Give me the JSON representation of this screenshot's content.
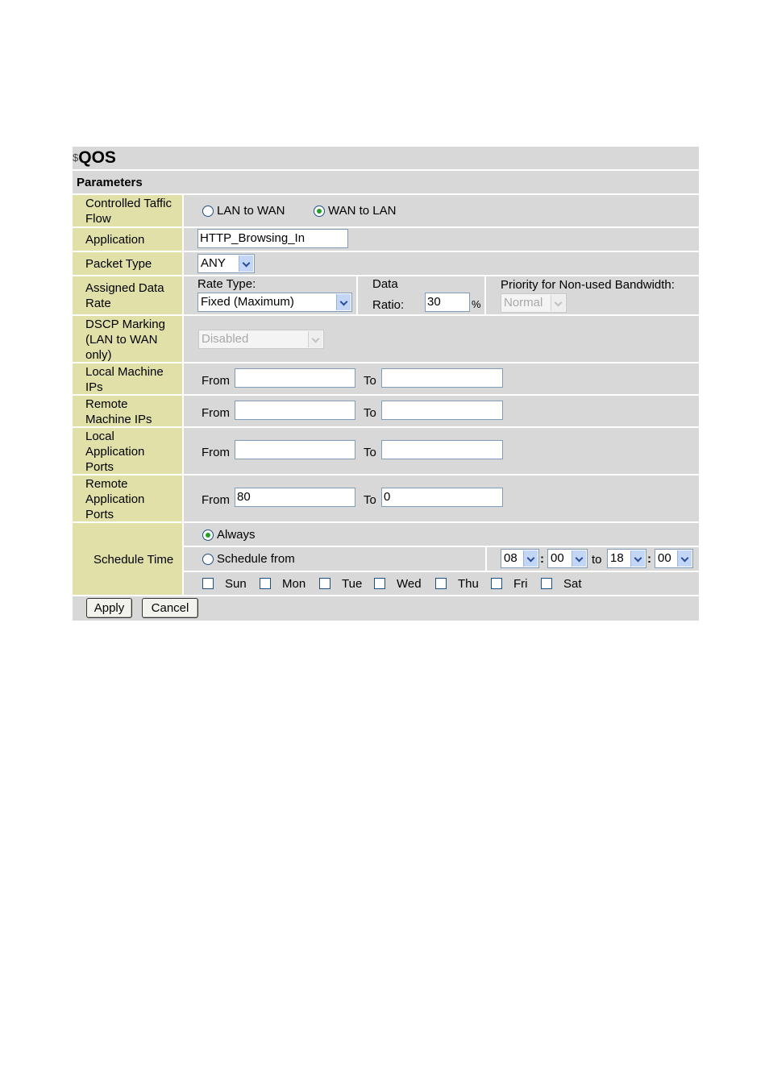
{
  "header": {
    "mark": "$",
    "title": "QOS",
    "section": "Parameters"
  },
  "controlled_traffic": {
    "label_lines": [
      "Controlled Taffic",
      "Flow"
    ],
    "options": [
      "LAN to WAN",
      "WAN to LAN"
    ],
    "selected": "WAN to LAN"
  },
  "application": {
    "label": "Application",
    "value": "HTTP_Browsing_In"
  },
  "packet_type": {
    "label": "Packet Type",
    "value": "ANY"
  },
  "assigned_rate": {
    "label_lines": [
      "Assigned Data",
      "Rate"
    ],
    "rate_type_label": "Rate Type:",
    "rate_type_value": "Fixed (Maximum)",
    "data_label": "Data",
    "ratio_label": "Ratio:",
    "ratio_value": "30",
    "percent": "%",
    "priority_label": "Priority for Non-used Bandwidth:",
    "priority_value": "Normal"
  },
  "dscp": {
    "label_lines": [
      "DSCP Marking",
      "(LAN to WAN",
      "only)"
    ],
    "value": "Disabled"
  },
  "local_ips": {
    "label_lines": [
      "Local Machine",
      "IPs"
    ],
    "from_label": "From",
    "to_label": "To",
    "from": "",
    "to": ""
  },
  "remote_ips": {
    "label_lines": [
      "Remote",
      "Machine IPs"
    ],
    "from_label": "From",
    "to_label": "To",
    "from": "",
    "to": ""
  },
  "local_ports": {
    "label_lines": [
      "Local",
      "Application",
      "Ports"
    ],
    "from_label": "From",
    "to_label": "To",
    "from": "",
    "to": ""
  },
  "remote_ports": {
    "label_lines": [
      "Remote",
      "Application",
      "Ports"
    ],
    "from_label": "From",
    "to_label": "To",
    "from": "80",
    "to": "0"
  },
  "schedule": {
    "label": "Schedule Time",
    "always_label": "Always",
    "from_label": "Schedule from",
    "selected": "Always",
    "start_hour": "08",
    "start_min": "00",
    "to_label": "to",
    "end_hour": "18",
    "end_min": "00",
    "colon": ":",
    "days": [
      "Sun",
      "Mon",
      "Tue",
      "Wed",
      "Thu",
      "Fri",
      "Sat"
    ]
  },
  "buttons": {
    "apply": "Apply",
    "cancel": "Cancel"
  }
}
